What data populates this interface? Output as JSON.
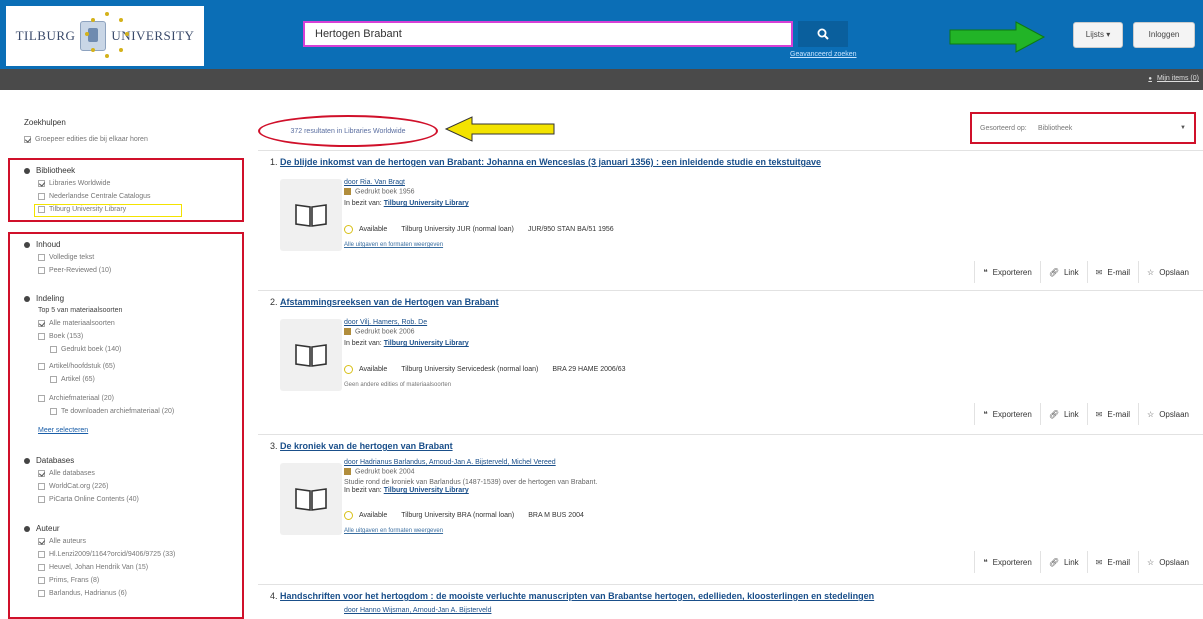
{
  "header": {
    "logo_left": "Tilburg",
    "logo_right": "University",
    "search_value": "Hertogen Brabant",
    "search_button_icon": "search-icon",
    "advanced_search": "Geavanceerd zoeken",
    "lists_label": "Lijsts ▾",
    "login_label": "Inloggen",
    "my_items": "Mijn items (0)"
  },
  "sidebar": {
    "title": "Zoekhulpen",
    "group_editions": "Groepeer edities die bij elkaar horen",
    "library": {
      "heading": "Bibliotheek",
      "items": [
        "Libraries Worldwide",
        "Nederlandse Centrale Catalogus",
        "Tilburg University Library"
      ]
    },
    "content": {
      "heading": "Inhoud",
      "items": [
        "Volledige tekst",
        "Peer-Reviewed (10)"
      ]
    },
    "format": {
      "heading": "Indeling",
      "subheading": "Top 5 van materiaalsoorten",
      "items": [
        "Alle materiaalsoorten",
        "Boek (153)",
        "Gedrukt boek (140)",
        "Artikel/hoofdstuk (65)",
        "Artikel (65)",
        "Archiefmateriaal (20)",
        "Te downloaden archiefmateriaal (20)"
      ],
      "more": "Meer selecteren"
    },
    "databases": {
      "heading": "Databases",
      "items": [
        "Alle databases",
        "WorldCat.org (226)",
        "PiCarta Online Contents (40)"
      ]
    },
    "author": {
      "heading": "Auteur",
      "items": [
        "Alle auteurs",
        "Hl.Lenzi2009/1164?orcid/9406/9725 (33)",
        "Heuvel, Johan Hendrik Van (15)",
        "Prims, Frans (8)",
        "Barlandus, Hadrianus (6)"
      ]
    }
  },
  "results": {
    "count": "372 resultaten in Libraries Worldwide",
    "sort_label": "Gesorteerd op:",
    "sort_value": "Bibliotheek",
    "actions": [
      "Exporteren",
      "Link",
      "E-mail",
      "Opslaan"
    ],
    "items": [
      {
        "num": "1.",
        "title": "De blijde inkomst van de hertogen van Brabant: Johanna en Wenceslas (3 januari 1356) : een inleidende studie en tekstuitgave",
        "author": "door Ria. Van Bragt",
        "format": "Gedrukt boek 1956",
        "owner_label": "In bezit van:",
        "owner": "Tilburg University Library",
        "availability": "Available",
        "location": "Tilburg University JUR (normal loan)",
        "callno": "JUR/950 STAN BA/51 1956",
        "more": "Alle uitgaven en formaten weergeven"
      },
      {
        "num": "2.",
        "title": "Afstammingsreeksen van de Hertogen van Brabant",
        "author": "door Vilj. Hamers, Rob. De",
        "format": "Gedrukt boek 2006",
        "owner_label": "In bezit van:",
        "owner": "Tilburg University Library",
        "availability": "Available",
        "location": "Tilburg University Servicedesk (normal loan)",
        "callno": "BRA 29 HAME 2006/63",
        "more": "Geen andere edities of materiaalsoorten"
      },
      {
        "num": "3.",
        "title": "De kroniek van de hertogen van Brabant",
        "author": "door Hadrianus Barlandus, Arnoud-Jan A. Bijsterveld, Michel Vereed",
        "format": "Gedrukt boek 2004",
        "desc": "Studie rond de kroniek van Barlandus (1487-1539) over de hertogen van Brabant.",
        "owner_label": "In bezit van:",
        "owner": "Tilburg University Library",
        "availability": "Available",
        "location": "Tilburg University BRA (normal loan)",
        "callno": "BRA M BUS 2004",
        "more": "Alle uitgaven en formaten weergeven"
      },
      {
        "num": "4.",
        "title": "Handschriften voor het hertogdom : de mooiste verluchte manuscripten van Brabantse hertogen, edellieden, kloosterlingen en stedelingen",
        "author": "door Hanno Wijsman, Arnoud-Jan A. Bijsterveld"
      }
    ]
  },
  "colors": {
    "header_blue": "#0b6eb6",
    "search_border": "#d63fd6",
    "annotation_red": "#d0102a",
    "annotation_yellow": "#f3e300",
    "annotation_green": "#22b427"
  }
}
